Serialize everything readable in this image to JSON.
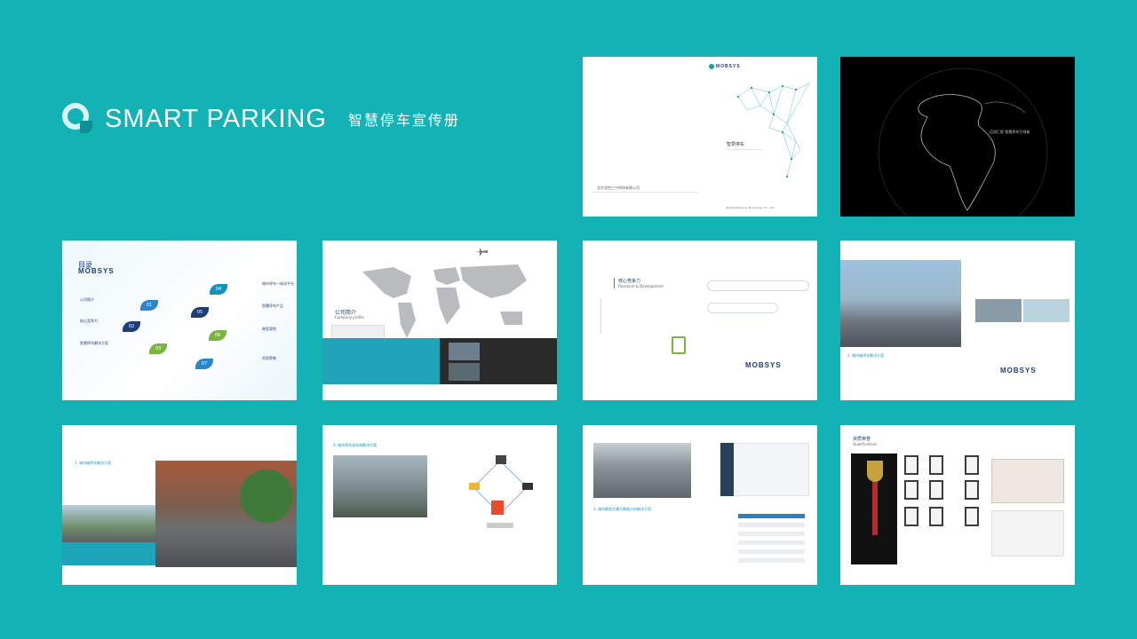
{
  "brand": {
    "title": "SMART PARKING",
    "subtitle": "智慧停车宣传册",
    "logo_icon": "q-logo-icon"
  },
  "colors": {
    "background": "#13b2b4",
    "accent_blue": "#1f3d7a",
    "teal": "#0f9aa8"
  },
  "pages": {
    "cover": {
      "logo": "MOBSYS",
      "title": "智慧停车",
      "company_cn": "北京北控三兴科技有限公司",
      "company_en": "Beijing Beikong Technology Co., Ltd."
    },
    "intro": {
      "tagline": "迈进汇智 智慧停车引领者"
    },
    "toc": {
      "title": "目录",
      "logo": "MOBSYS",
      "items_left": [
        "公司简介",
        "核心竞争力",
        "智慧停车解决方案"
      ],
      "items_right": [
        "城市停车一体化平台",
        "智慧停车产品",
        "典型案例",
        "资质荣誉"
      ],
      "numbers": [
        "01",
        "02",
        "03",
        "04",
        "05",
        "06",
        "07"
      ]
    },
    "company": {
      "title": "公司简介",
      "title_en": "Company profile"
    },
    "core": {
      "title": "核心竞争力",
      "title_en": "Research & Development",
      "logo": "MOBSYS"
    },
    "solution": {
      "heading": "2. 城市级停车解决方案",
      "logo": "MOBSYS"
    },
    "city": {
      "heading": "1. 城市级停车解决方案"
    },
    "smart": {
      "heading": "4. 城市停车场系统解决方案"
    },
    "platform": {
      "heading": "3. 城市静态交通大数据分析解决方案"
    },
    "honor": {
      "title": "资质荣誉",
      "title_en": "Qualifications"
    }
  }
}
